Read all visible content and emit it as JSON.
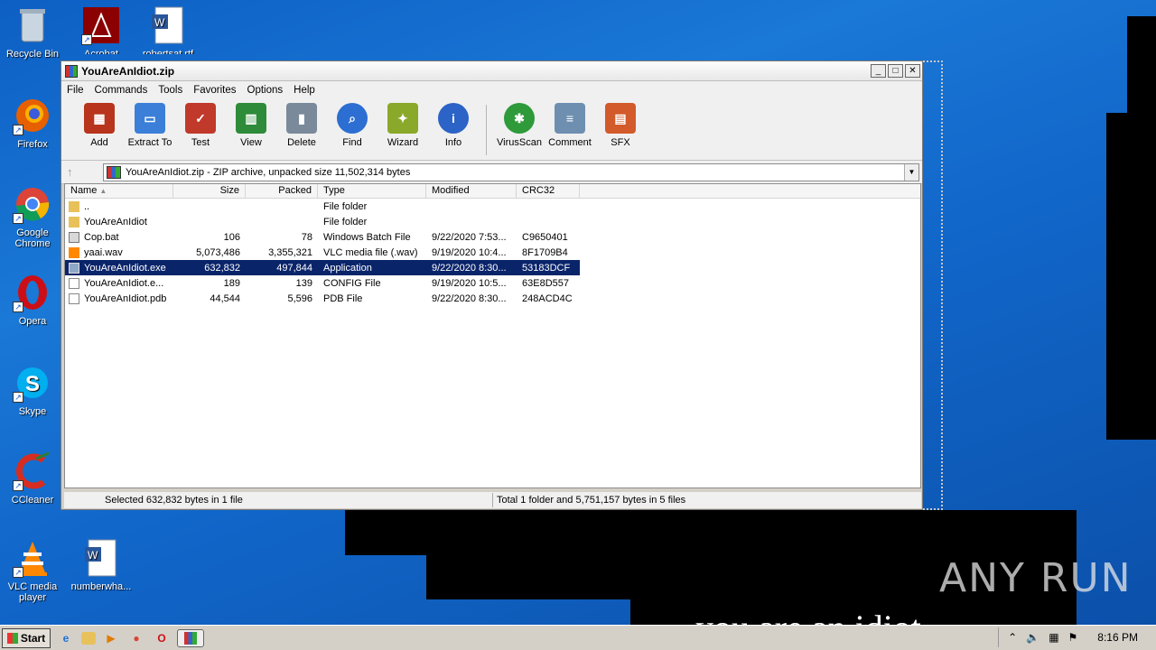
{
  "desktop": {
    "icons": [
      {
        "label": "Recycle Bin",
        "icon": "recycle-bin-icon"
      },
      {
        "label": "Acrobat",
        "icon": "acrobat-icon"
      },
      {
        "label": "robertsat.rtf",
        "icon": "word-document-icon"
      },
      {
        "label": "Firefox",
        "icon": "firefox-icon"
      },
      {
        "label": "Google Chrome",
        "icon": "chrome-icon"
      },
      {
        "label": "Opera",
        "icon": "opera-icon"
      },
      {
        "label": "Skype",
        "icon": "skype-icon"
      },
      {
        "label": "CCleaner",
        "icon": "ccleaner-icon"
      },
      {
        "label": "VLC media player",
        "icon": "vlc-icon"
      },
      {
        "label": "numberwha...",
        "icon": "word-document-icon"
      }
    ],
    "overlay_text": "you are an idiot",
    "watermark": "ANY RUN"
  },
  "window": {
    "title": "YouAreAnIdiot.zip",
    "controls": {
      "minimize": "_",
      "maximize": "□",
      "close": "✕"
    },
    "menu": [
      "File",
      "Commands",
      "Tools",
      "Favorites",
      "Options",
      "Help"
    ],
    "toolbar": [
      {
        "label": "Add",
        "icon": "add-archive-icon",
        "color": "#b8341c"
      },
      {
        "label": "Extract To",
        "icon": "extract-folder-icon",
        "color": "#3b7fd8"
      },
      {
        "label": "Test",
        "icon": "test-clipboard-icon",
        "color": "#c0392b"
      },
      {
        "label": "View",
        "icon": "view-book-icon",
        "color": "#2e8b3a"
      },
      {
        "label": "Delete",
        "icon": "delete-trash-icon",
        "color": "#7a8a9a"
      },
      {
        "label": "Find",
        "icon": "find-magnifier-icon",
        "color": "#2c6ed1"
      },
      {
        "label": "Wizard",
        "icon": "wizard-wand-icon",
        "color": "#8aa82a"
      },
      {
        "label": "Info",
        "icon": "info-icon",
        "color": "#2b63c6"
      },
      {
        "label": "VirusScan",
        "icon": "virus-scan-icon",
        "color": "#2e9a3a"
      },
      {
        "label": "Comment",
        "icon": "comment-icon",
        "color": "#6e8fb0"
      },
      {
        "label": "SFX",
        "icon": "sfx-books-icon",
        "color": "#d35a2a"
      }
    ],
    "address": "YouAreAnIdiot.zip - ZIP archive, unpacked size 11,502,314 bytes",
    "columns": [
      "Name",
      "Size",
      "Packed",
      "Type",
      "Modified",
      "CRC32"
    ],
    "sort_indicator": "▲",
    "files": [
      {
        "name": "..",
        "size": "",
        "packed": "",
        "type": "File folder",
        "modified": "",
        "crc": "",
        "icon": "folder-up-icon",
        "selected": false
      },
      {
        "name": "YouAreAnIdiot",
        "size": "",
        "packed": "",
        "type": "File folder",
        "modified": "",
        "crc": "",
        "icon": "folder-icon",
        "selected": false
      },
      {
        "name": "Cop.bat",
        "size": "106",
        "packed": "78",
        "type": "Windows Batch File",
        "modified": "9/22/2020 7:53...",
        "crc": "C9650401",
        "icon": "batch-file-icon",
        "selected": false
      },
      {
        "name": "yaai.wav",
        "size": "5,073,486",
        "packed": "3,355,321",
        "type": "VLC media file (.wav)",
        "modified": "9/19/2020 10:4...",
        "crc": "8F1709B4",
        "icon": "vlc-file-icon",
        "selected": false
      },
      {
        "name": "YouAreAnIdiot.exe",
        "size": "632,832",
        "packed": "497,844",
        "type": "Application",
        "modified": "9/22/2020 8:30...",
        "crc": "53183DCF",
        "icon": "exe-file-icon",
        "selected": true
      },
      {
        "name": "YouAreAnIdiot.e...",
        "size": "189",
        "packed": "139",
        "type": "CONFIG File",
        "modified": "9/19/2020 10:5...",
        "crc": "63E8D557",
        "icon": "config-file-icon",
        "selected": false
      },
      {
        "name": "YouAreAnIdiot.pdb",
        "size": "44,544",
        "packed": "5,596",
        "type": "PDB File",
        "modified": "9/22/2020 8:30...",
        "crc": "248ACD4C",
        "icon": "pdb-file-icon",
        "selected": false
      }
    ],
    "status_left": "Selected 632,832 bytes in 1 file",
    "status_right": "Total 1 folder and 5,751,157 bytes in 5 files"
  },
  "taskbar": {
    "start": "Start",
    "clock": "8:16 PM"
  }
}
